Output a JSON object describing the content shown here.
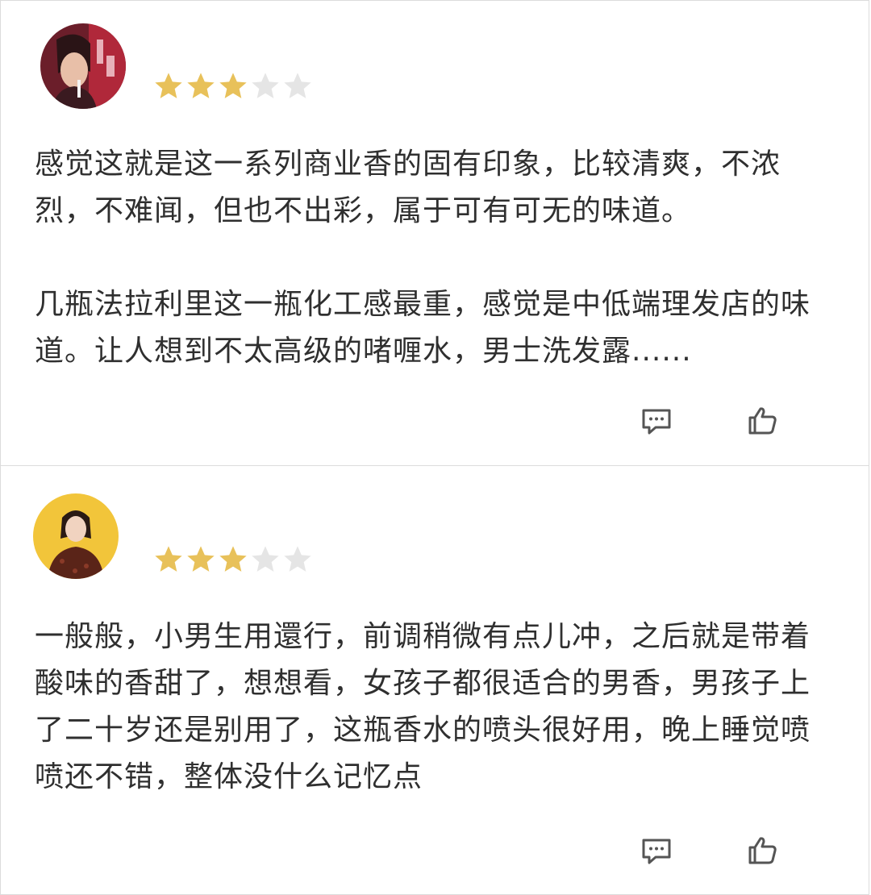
{
  "reviews": [
    {
      "rating": 3,
      "max_rating": 5,
      "text": "感觉这就是这一系列商业香的固有印象，比较清爽，不浓\n烈，不难闻，但也不出彩，属于可有可无的味道。\n\n几瓶法拉利里这一瓶化工感最重，感觉是中低端理发店的味\n道。让人想到不太高级的啫喱水，男士洗发露......"
    },
    {
      "rating": 3,
      "max_rating": 5,
      "text": "一般般，小男生用還行，前调稍微有点儿冲，之后就是带着\n酸味的香甜了，想想看，女孩子都很适合的男香，男孩子上\n了二十岁还是别用了，这瓶香水的喷头很好用，晚上睡觉喷\n喷还不错，整体没什么记忆点"
    }
  ],
  "icons": {
    "comment": "comment-icon",
    "like": "thumbs-up-icon",
    "star": "star-icon"
  },
  "colors": {
    "star_filled": "#E8C15A",
    "star_empty": "#E5E5E5",
    "text": "#2F2F2F",
    "icon": "#555555",
    "divider": "#DCDCDC",
    "avatar2_bg": "#F2C53A"
  }
}
